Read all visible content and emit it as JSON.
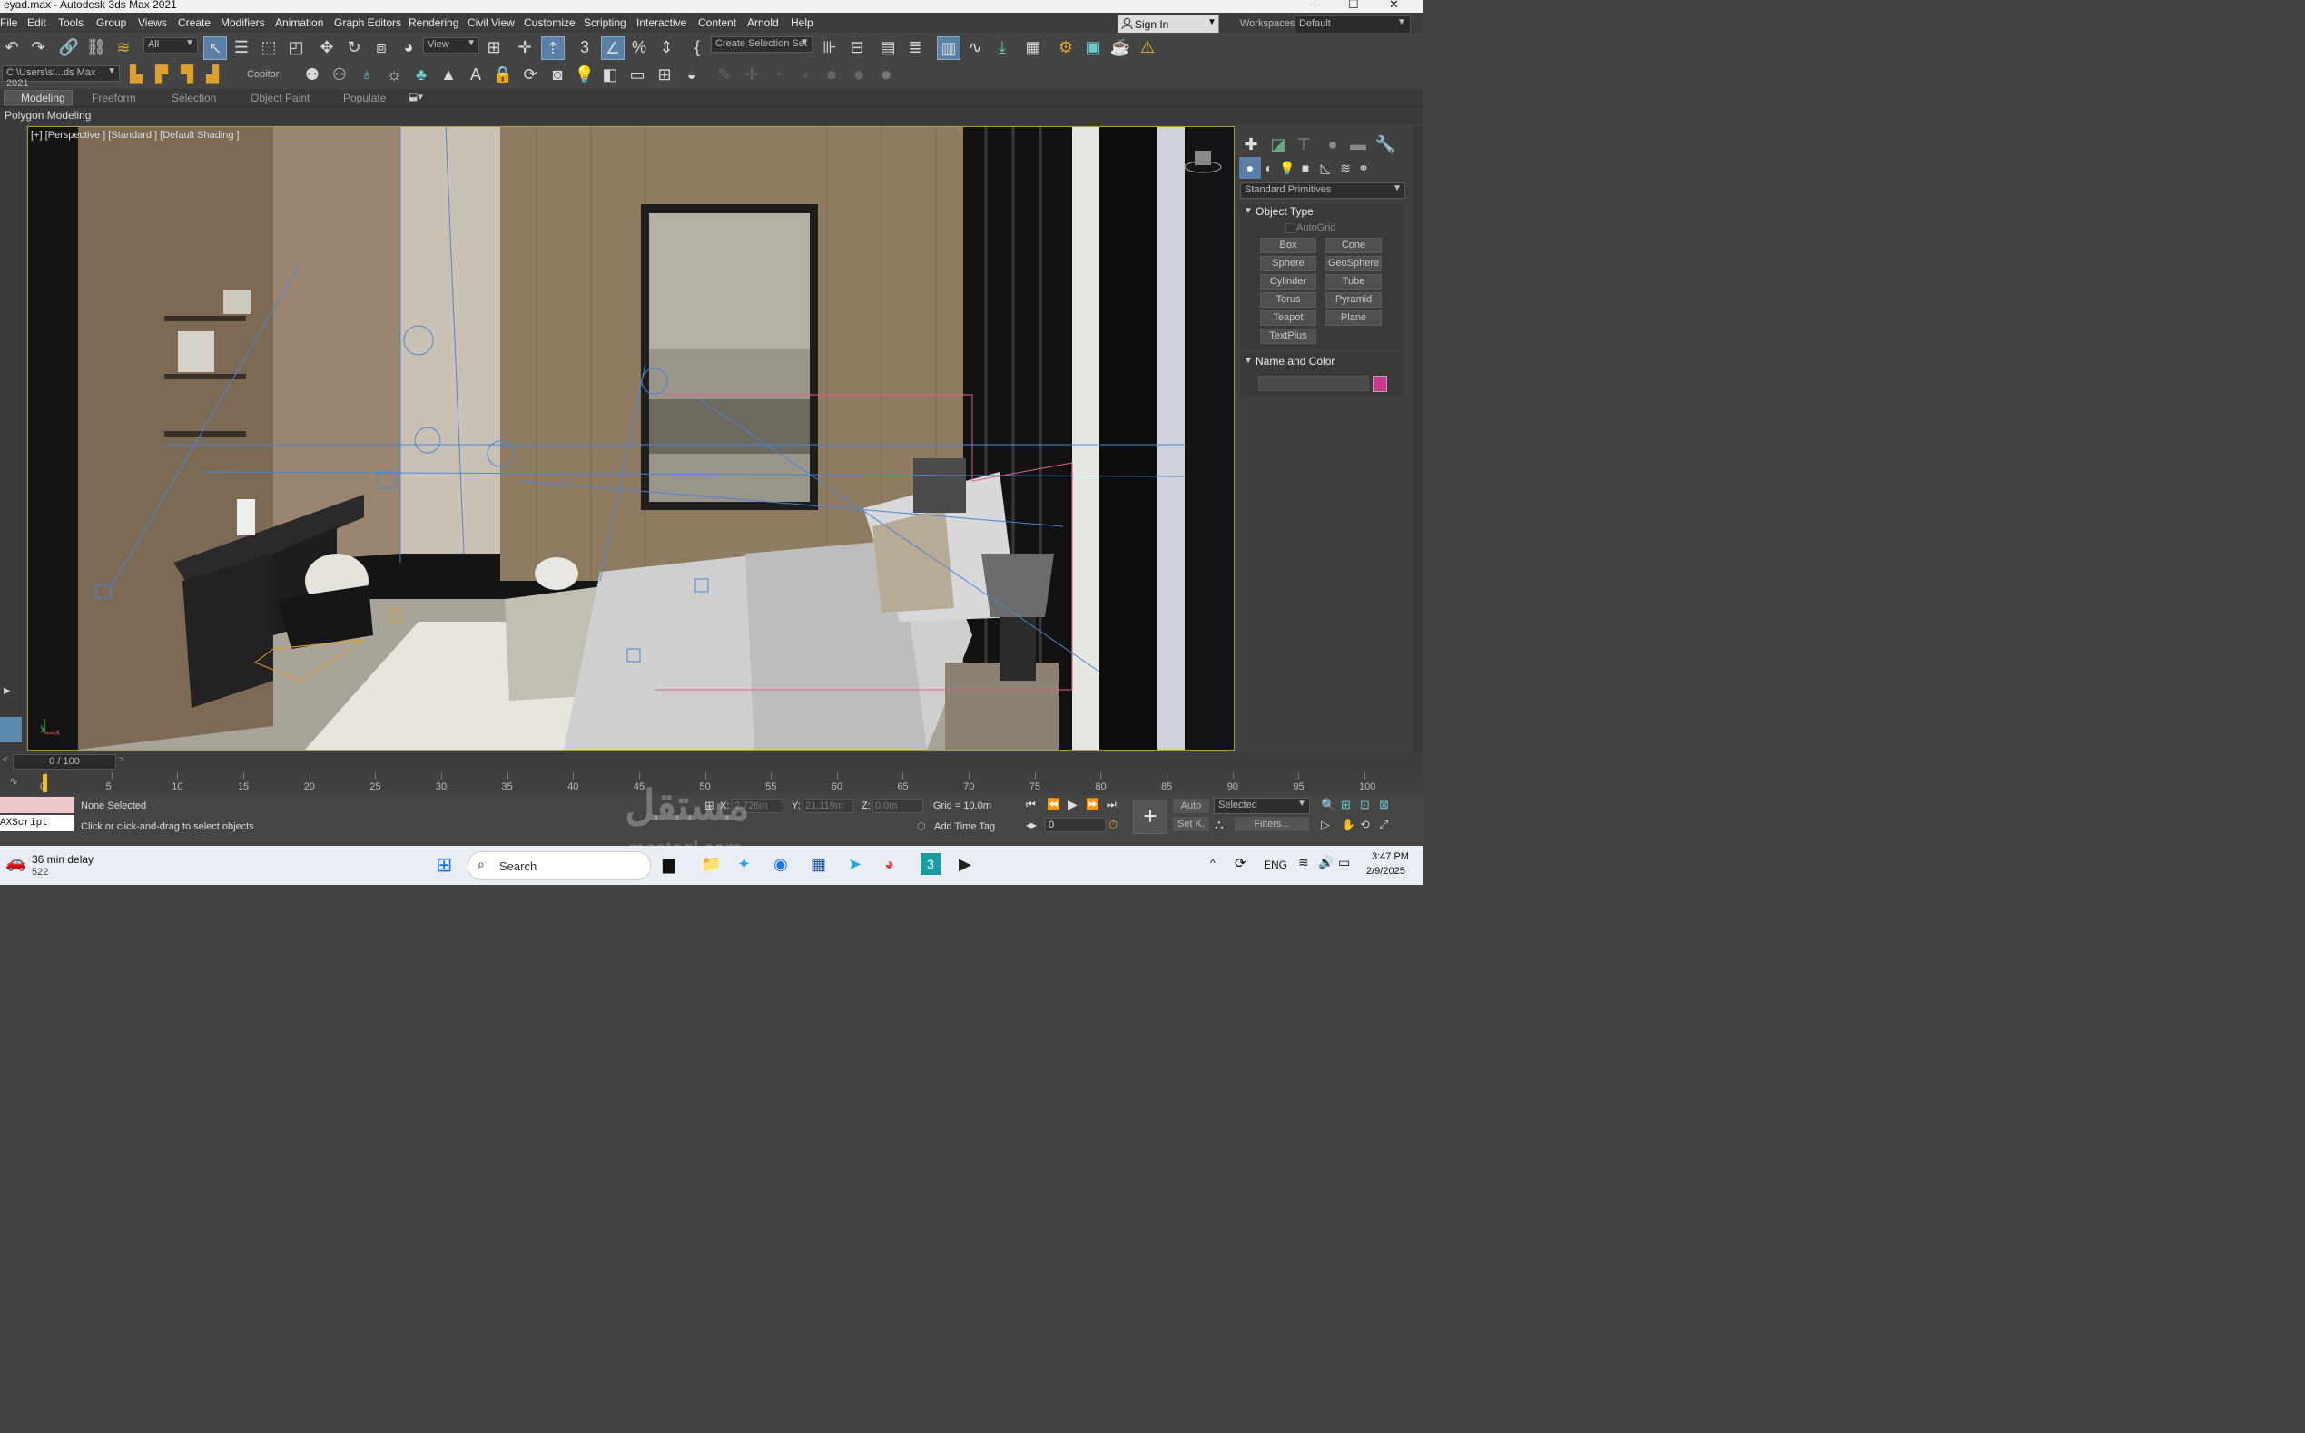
{
  "window": {
    "title": "eyad.max - Autodesk 3ds Max 2021"
  },
  "menu": {
    "items": [
      "File",
      "Edit",
      "Tools",
      "Group",
      "Views",
      "Create",
      "Modifiers",
      "Animation",
      "Graph Editors",
      "Rendering",
      "Civil View",
      "Customize",
      "Scripting",
      "Interactive",
      "Content",
      "Arnold",
      "Help"
    ]
  },
  "account": {
    "sign_in": "Sign In",
    "workspaces_label": "Workspaces:",
    "workspace_value": "Default"
  },
  "toolbar": {
    "filter_value": "All",
    "ref_coord_value": "View",
    "selection_set_placeholder": "Create Selection Set",
    "path_value": "C:\\Users\\sl...ds Max 2021",
    "copitor_label": "Copitor"
  },
  "ribbon": {
    "tabs": [
      "Modeling",
      "Freeform",
      "Selection",
      "Object Paint",
      "Populate"
    ],
    "active_tab": "Modeling",
    "panel_label": "Polygon Modeling"
  },
  "viewport": {
    "label": "[+] [Perspective ] [Standard ] [Default Shading ]"
  },
  "command_panel": {
    "category_value": "Standard Primitives",
    "object_type_header": "Object Type",
    "autogrid_label": "AutoGrid",
    "primitives": [
      "Box",
      "Cone",
      "Sphere",
      "GeoSphere",
      "Cylinder",
      "Tube",
      "Torus",
      "Pyramid",
      "Teapot",
      "Plane",
      "TextPlus"
    ],
    "name_color_header": "Name and Color",
    "object_color": "#c8368f"
  },
  "time_slider": {
    "value": "0 / 100"
  },
  "trackbar": {
    "ticks": [
      "0",
      "5",
      "10",
      "15",
      "20",
      "25",
      "30",
      "35",
      "40",
      "45",
      "50",
      "55",
      "60",
      "65",
      "70",
      "75",
      "80",
      "85",
      "90",
      "95",
      "100"
    ]
  },
  "status": {
    "maxscript_label": "AXScript Mini",
    "selection_status": "None Selected",
    "prompt": "Click or click-and-drag to select objects",
    "x_label": "X:",
    "x_value": "2.726m",
    "y_label": "Y:",
    "y_value": "21.119m",
    "z_label": "Z:",
    "z_value": "0.0m",
    "grid": "Grid = 10.0m",
    "add_time_tag": "Add Time Tag",
    "frame_value": "0",
    "auto_key": "Auto",
    "set_key": "Set K.",
    "key_filter_value": "Selected",
    "filters": "Filters..."
  },
  "taskbar": {
    "weather_title": "36 min delay",
    "weather_sub": "522",
    "search_placeholder": "Search",
    "language": "ENG",
    "time": "3:47 PM",
    "date": "2/9/2025"
  },
  "watermark": "mostaql.com"
}
